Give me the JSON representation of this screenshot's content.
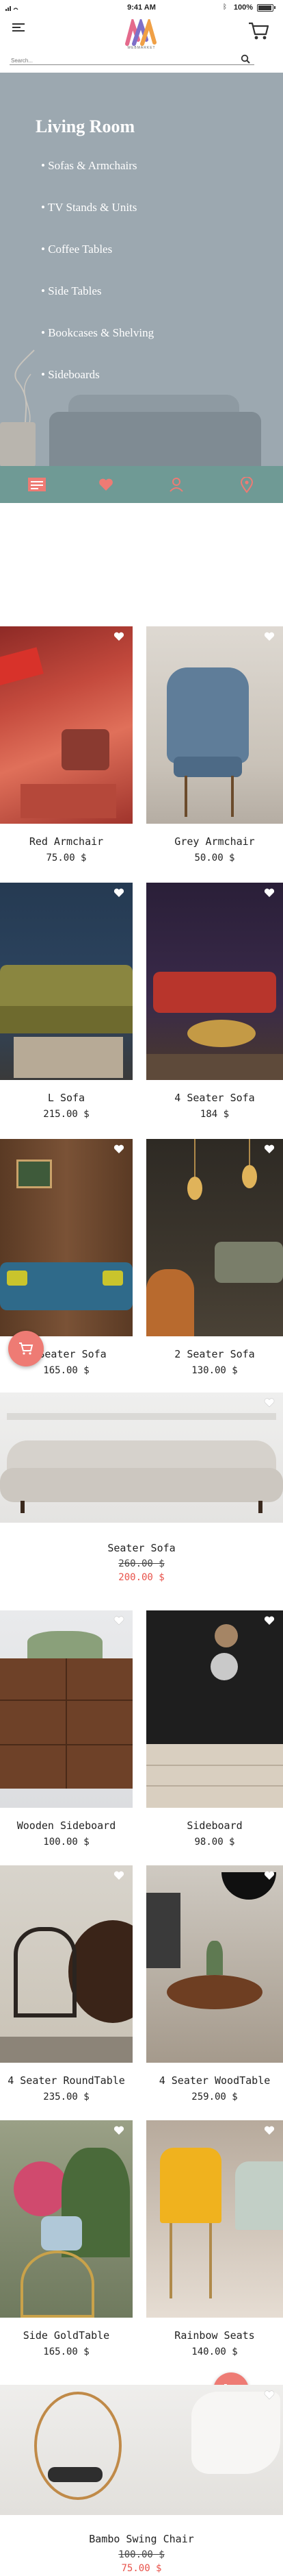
{
  "status_bar": {
    "time": "9:41 AM",
    "battery": "100%"
  },
  "header": {
    "logo_text": "WEBMARKET",
    "search_placeholder": "Search..."
  },
  "category_panel": {
    "title": "Living Room",
    "items": [
      "• Sofas & Armchairs",
      "• TV Stands & Units",
      "• Coffee Tables",
      "• Side Tables",
      "• Bookcases & Shelving",
      "• Sideboards"
    ]
  },
  "tab_bar": {
    "tabs": [
      "home-icon",
      "heart-icon",
      "user-icon",
      "location-icon"
    ],
    "active_color": "#ee7b74",
    "bar_color": "#6f9a95"
  },
  "currency": "$",
  "products": [
    {
      "name": "Red Armchair",
      "price": "75.00 $"
    },
    {
      "name": "Grey Armchair",
      "price": "50.00 $"
    },
    {
      "name": "L Sofa",
      "price": "215.00 $"
    },
    {
      "name": "4 Seater Sofa",
      "price": "184 $"
    },
    {
      "name": "3 Seater Sofa",
      "price": "165.00 $"
    },
    {
      "name": "2 Seater Sofa",
      "price": "130.00 $"
    },
    {
      "name": "Seater Sofa",
      "old_price": "260.00 $",
      "price": "200.00 $"
    },
    {
      "name": "Wooden Sideboard",
      "price": "100.00 $"
    },
    {
      "name": "Sideboard",
      "price": "98.00 $"
    },
    {
      "name": "4 Seater RoundTable",
      "price": "235.00 $"
    },
    {
      "name": "4 Seater WoodTable",
      "price": "259.00 $"
    },
    {
      "name": "Side GoldTable",
      "price": "165.00 $"
    },
    {
      "name": "Rainbow Seats",
      "price": "140.00 $"
    },
    {
      "name": "Bambo Swing Chair",
      "old_price": "100.00 $",
      "price": "75.00 $"
    }
  ]
}
